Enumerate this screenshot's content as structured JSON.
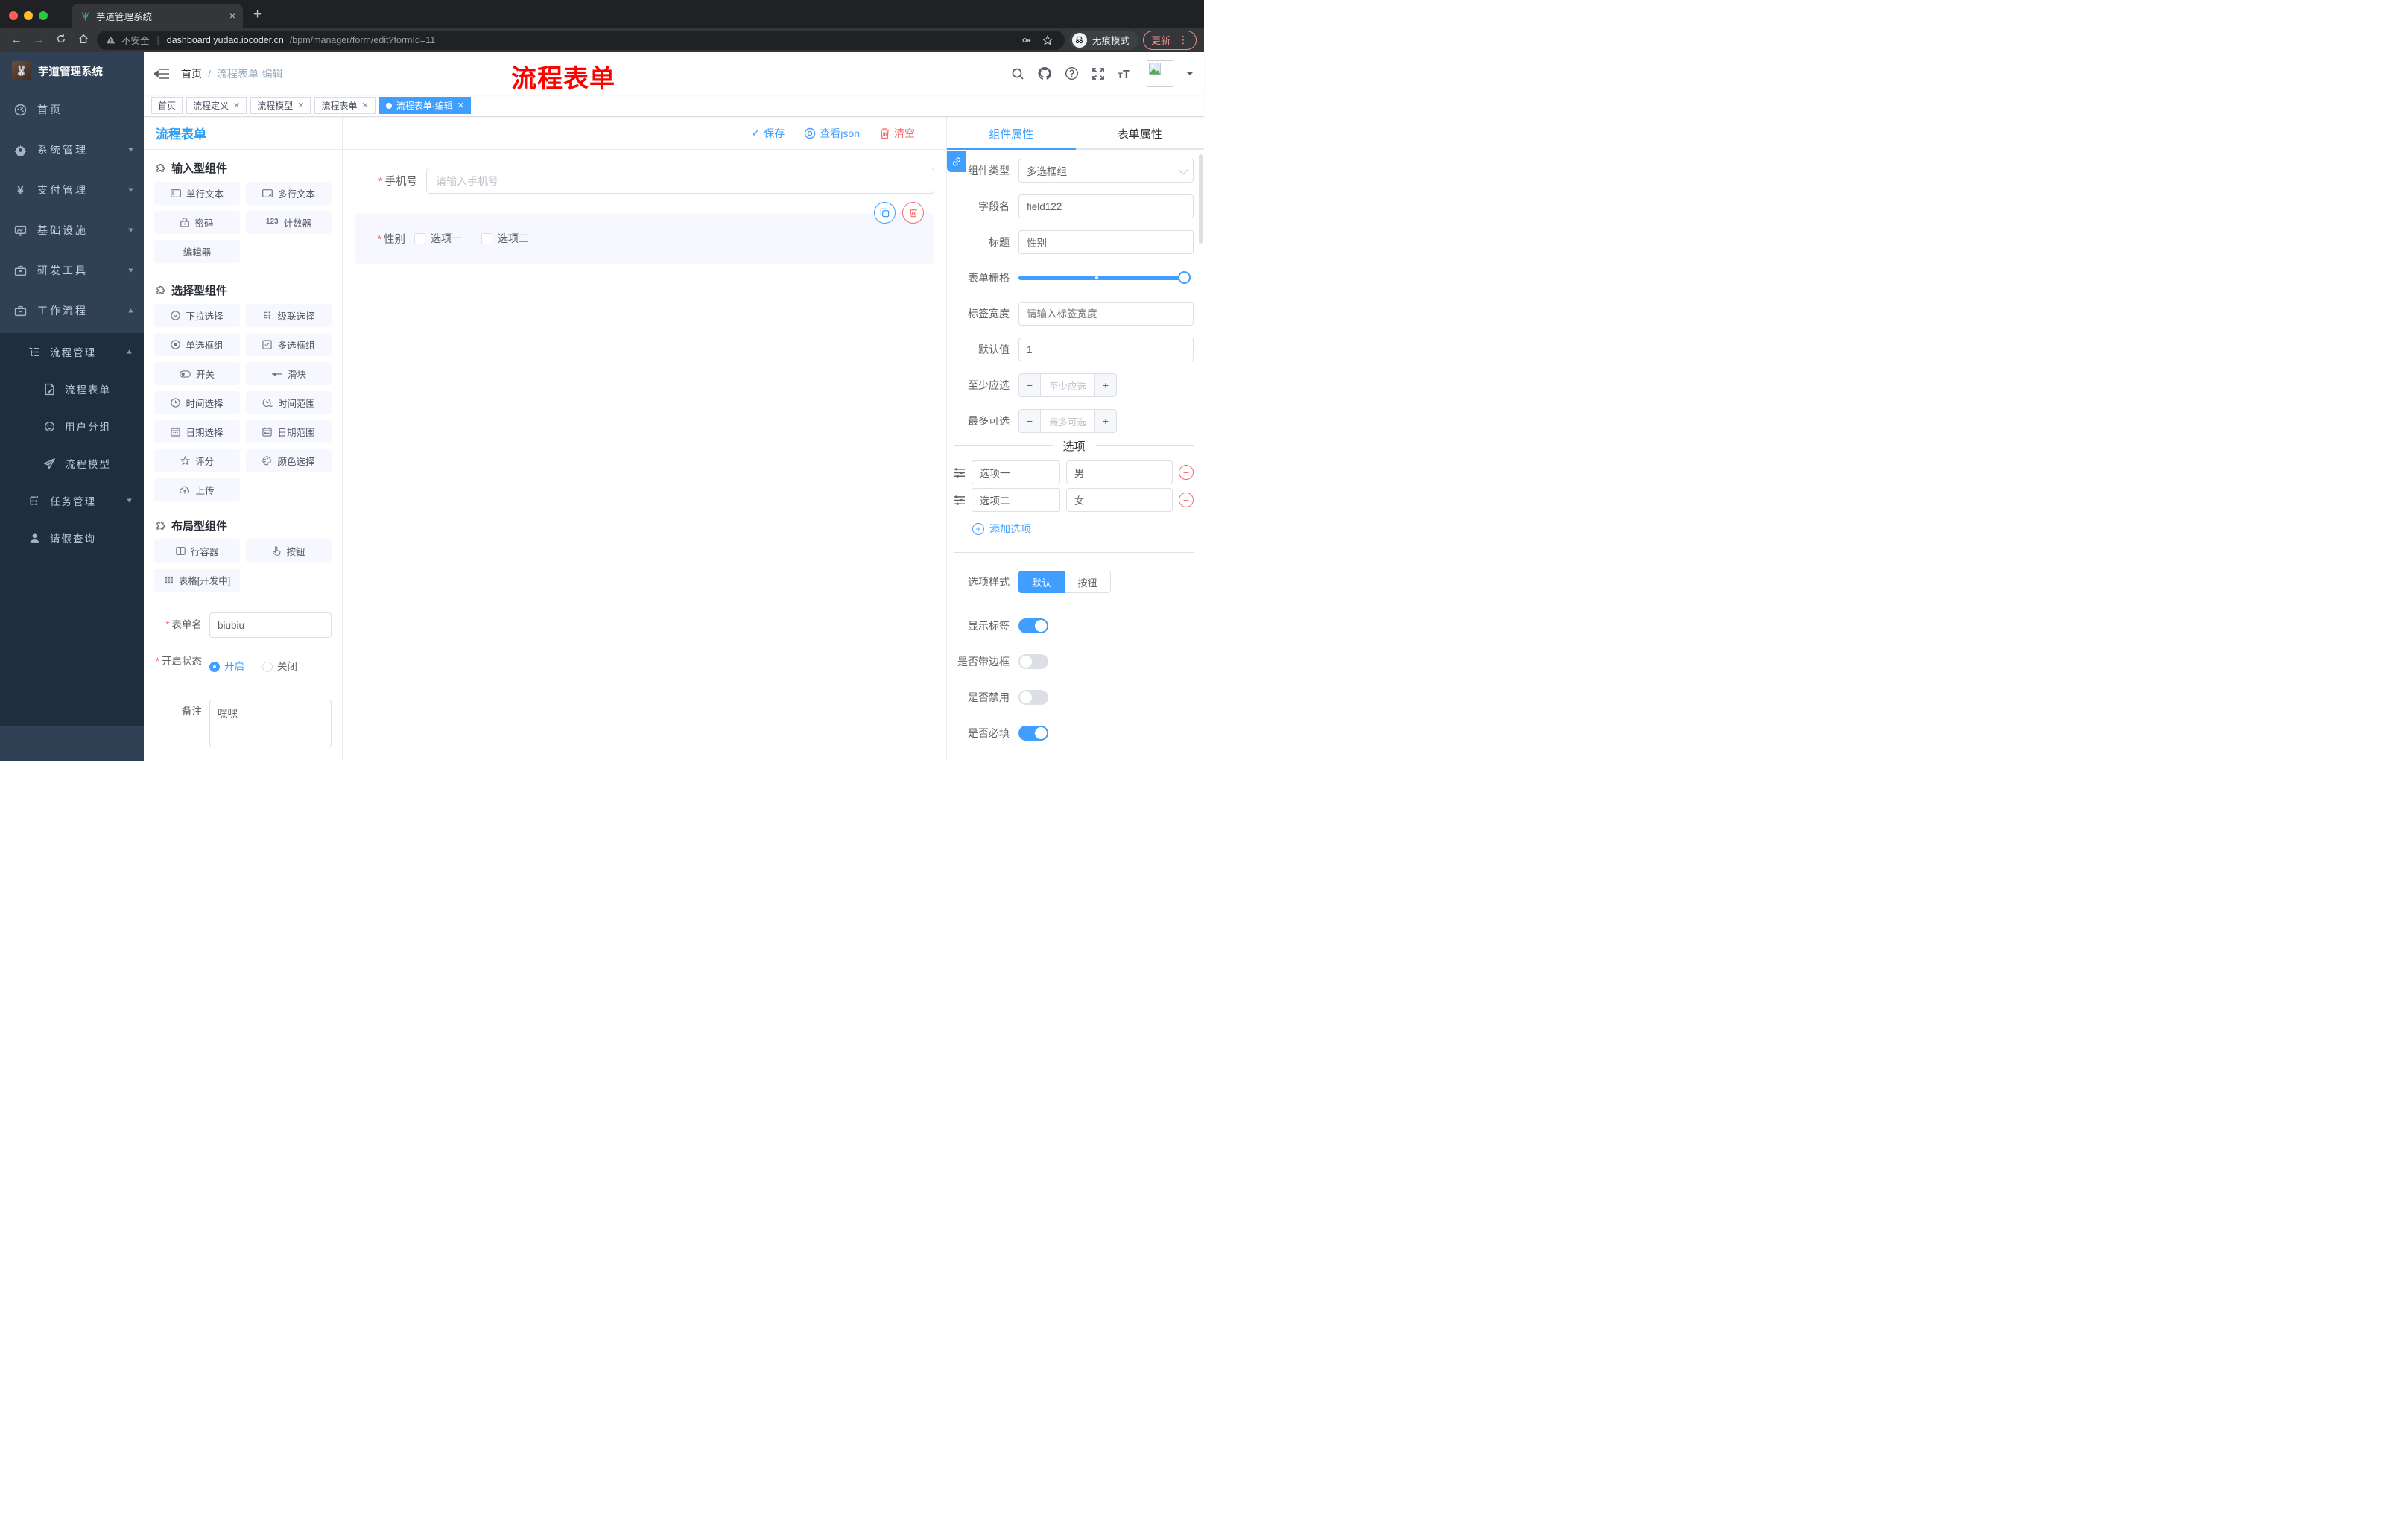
{
  "browser": {
    "tab_title": "芋道管理系统",
    "close_glyph": "×",
    "url": {
      "warning": "不安全",
      "host": "dashboard.yudao.iocoder.cn",
      "path": "/bpm/manager/form/edit?formId=11"
    },
    "incognito_label": "无痕模式",
    "update_label": "更新"
  },
  "annotation": "流程表单",
  "sidebar": {
    "title": "芋道管理系统",
    "menu": [
      {
        "label": "首页",
        "arrow": ""
      },
      {
        "label": "系统管理",
        "arrow": "v"
      },
      {
        "label": "支付管理",
        "arrow": "v"
      },
      {
        "label": "基础设施",
        "arrow": "v"
      },
      {
        "label": "研发工具",
        "arrow": "v"
      },
      {
        "label": "工作流程",
        "arrow": "^"
      }
    ],
    "submenu": {
      "manage": "流程管理",
      "children": [
        {
          "label": "流程表单"
        },
        {
          "label": "用户分组"
        },
        {
          "label": "流程模型"
        }
      ],
      "task": "任务管理",
      "leave": "请假查询"
    }
  },
  "navbar": {
    "breadcrumb1": "首页",
    "separator": "/",
    "breadcrumb2": "流程表单-编辑"
  },
  "tags": [
    {
      "label": "首页"
    },
    {
      "label": "流程定义"
    },
    {
      "label": "流程模型"
    },
    {
      "label": "流程表单"
    },
    {
      "label": "流程表单-编辑"
    }
  ],
  "palette": {
    "title": "流程表单",
    "sec_input": "输入型组件",
    "sec_select": "选择型组件",
    "sec_layout": "布局型组件",
    "counter_glyph": "123",
    "input_items": [
      {
        "label": "单行文本"
      },
      {
        "label": "多行文本"
      },
      {
        "label": "密码"
      },
      {
        "label": "计数器"
      },
      {
        "label": "编辑器"
      }
    ],
    "select_items": [
      {
        "label": "下拉选择"
      },
      {
        "label": "级联选择"
      },
      {
        "label": "单选框组"
      },
      {
        "label": "多选框组"
      },
      {
        "label": "开关"
      },
      {
        "label": "滑块"
      },
      {
        "label": "时间选择"
      },
      {
        "label": "时间范围"
      },
      {
        "label": "日期选择"
      },
      {
        "label": "日期范围"
      },
      {
        "label": "评分"
      },
      {
        "label": "颜色选择"
      },
      {
        "label": "上传"
      }
    ],
    "layout_items": [
      {
        "label": "行容器"
      },
      {
        "label": "按钮"
      },
      {
        "label": "表格[开发中]"
      }
    ],
    "meta": {
      "name_label": "表单名",
      "name_value": "biubiu",
      "status_label": "开启状态",
      "status_on": "开启",
      "status_off": "关闭",
      "remark_label": "备注",
      "remark_value": "嘿嘿"
    }
  },
  "canvas": {
    "toolbar": {
      "save": "保存",
      "view_json": "查看json",
      "clear": "清空"
    },
    "phone": {
      "label": "手机号",
      "placeholder": "请输入手机号"
    },
    "gender": {
      "label": "性别",
      "option1": "选项一",
      "option2": "选项二"
    }
  },
  "props": {
    "tab_component": "组件属性",
    "tab_form": "表单属性",
    "type_label": "组件类型",
    "type_value": "多选框组",
    "field_label": "字段名",
    "field_value": "field122",
    "title_label": "标题",
    "title_value": "性别",
    "grid_label": "表单栅格",
    "width_label": "标签宽度",
    "width_placeholder": "请输入标签宽度",
    "default_label": "默认值",
    "default_value": "1",
    "min_label": "至少应选",
    "min_placeholder": "至少应选",
    "max_label": "最多可选",
    "max_placeholder": "最多可选",
    "options_title": "选项",
    "options": [
      {
        "label": "选项一",
        "value": "男"
      },
      {
        "label": "选项二",
        "value": "女"
      }
    ],
    "add_option": "添加选项",
    "style_label": "选项样式",
    "style_default": "默认",
    "style_button": "按钮",
    "show_label": "显示标签",
    "border_label": "是否带边框",
    "disabled_label": "是否禁用",
    "required_label": "是否必填"
  },
  "colors": {
    "accent": "#409eff",
    "danger": "#f56c6c",
    "title_blue": "#2d9ff7",
    "sidebar": "#304156",
    "sidebar_dark": "#1f2d3d"
  }
}
